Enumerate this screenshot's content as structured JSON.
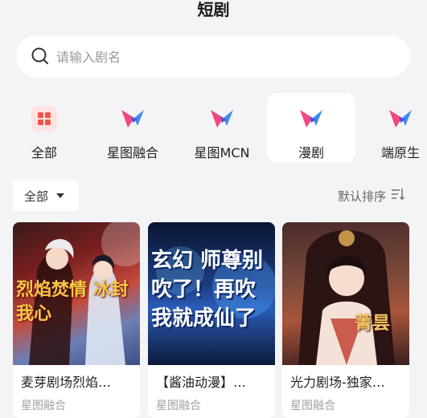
{
  "header": {
    "title": "短剧"
  },
  "search": {
    "placeholder": "请输入剧名"
  },
  "categories": [
    {
      "label": "全部",
      "icon": "grid-icon"
    },
    {
      "label": "星图融合",
      "icon": "xingtu-logo-icon"
    },
    {
      "label": "星图MCN",
      "icon": "xingtu-logo-icon"
    },
    {
      "label": "漫剧",
      "icon": "xingtu-logo-icon"
    },
    {
      "label": "端原生",
      "icon": "xingtu-logo-icon"
    }
  ],
  "active_category": "漫剧",
  "filter": {
    "selected": "全部"
  },
  "sort": {
    "label": "默认排序"
  },
  "cards": [
    {
      "title": "麦芽剧场烈焰…",
      "tag": "星图融合",
      "poster_text": "烈焰焚情 冰封我心"
    },
    {
      "title": "【酱油动漫】…",
      "tag": "星图融合",
      "poster_text": "玄幻 师尊别吹了！再吹我就成仙了"
    },
    {
      "title": "光力剧场-独家…",
      "tag": "星图融合",
      "poster_text": "菁昙"
    }
  ],
  "colors": {
    "accent_red": "#f0554a",
    "accent_blue": "#3b8df0",
    "accent_pink": "#f2477e"
  }
}
